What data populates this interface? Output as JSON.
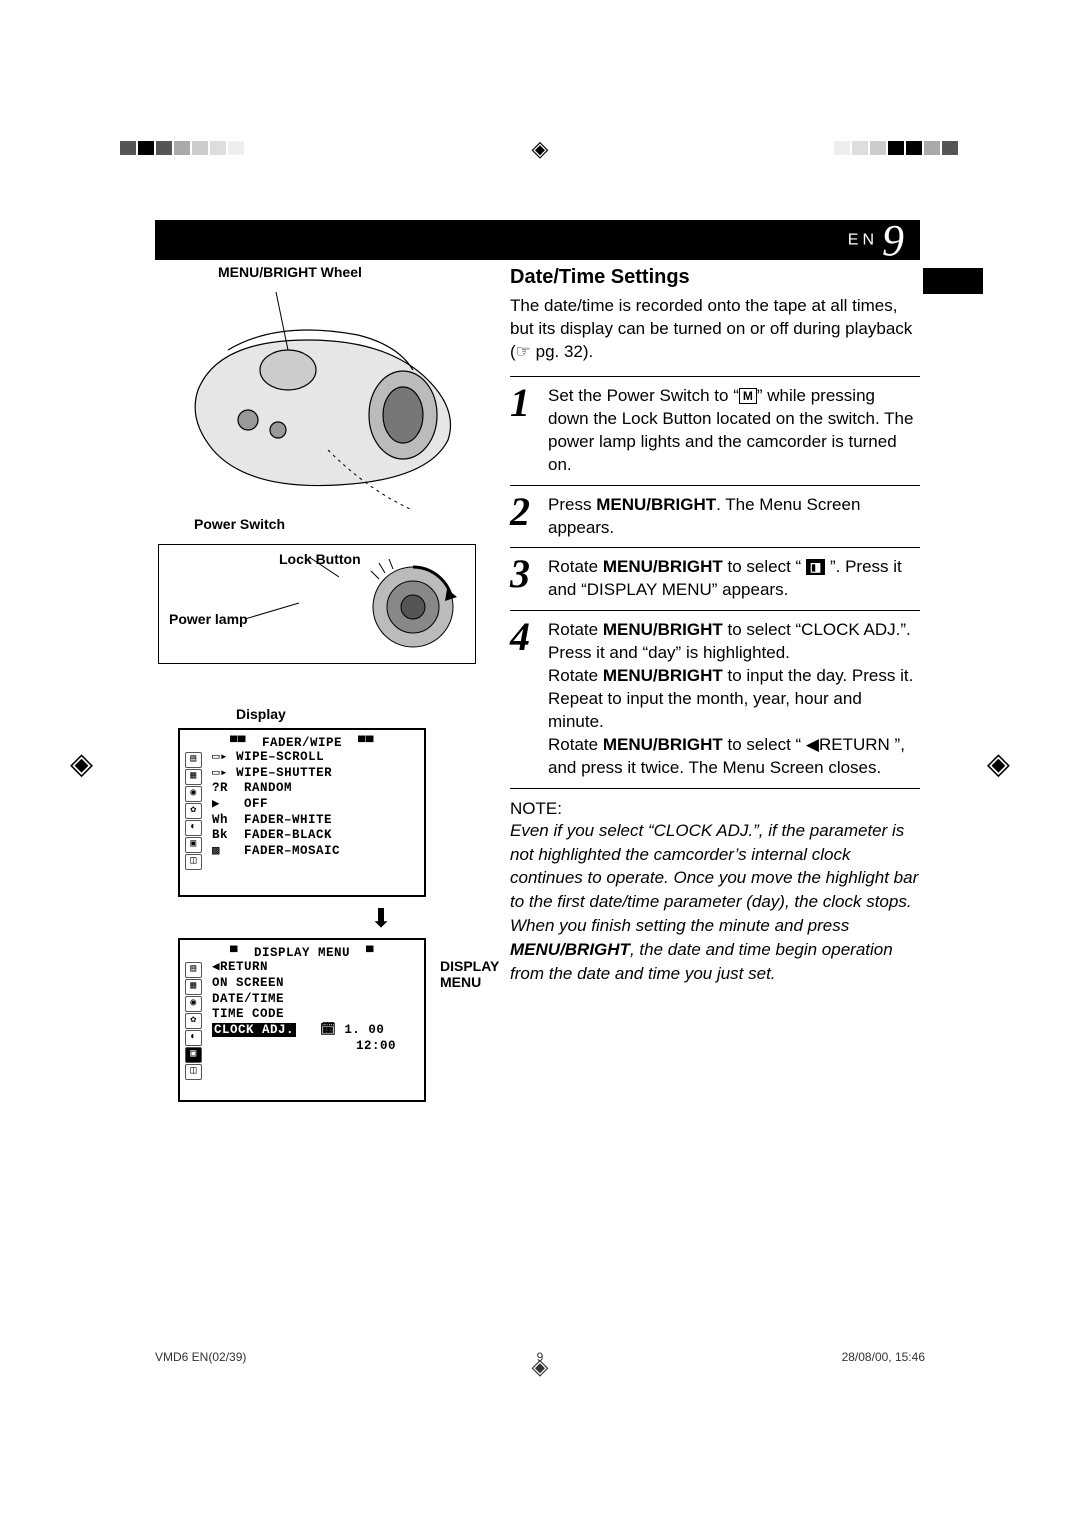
{
  "header": {
    "lang": "EN",
    "page_number": "9"
  },
  "left": {
    "wheel_label": "MENU/BRIGHT Wheel",
    "power_switch_label": "Power Switch",
    "lock_button_label": "Lock Button",
    "power_lamp_label": "Power lamp",
    "display_label": "Display",
    "osd1": {
      "title": "FADER/WIPE",
      "items": [
        "WIPE–SCROLL",
        "WIPE–SHUTTER",
        "RANDOM",
        "OFF",
        "FADER–WHITE",
        "FADER–BLACK",
        "FADER–MOSAIC"
      ]
    },
    "osd2_side_label": "DISPLAY MENU",
    "osd2": {
      "title": "DISPLAY MENU",
      "items": [
        "◀RETURN",
        "ON SCREEN",
        "DATE/TIME",
        "TIME CODE"
      ],
      "highlight": "CLOCK ADJ.",
      "clock_date": "1. 00",
      "clock_time": "12:00"
    }
  },
  "right": {
    "title": "Date/Time Settings",
    "intro": "The date/time is recorded onto the tape at all times, but its display can be turned on or off during playback (☞ pg. 32).",
    "step1": "Set the Power Switch to “ M ” while pressing down the Lock Button located on the switch. The power lamp lights and the camcorder is turned on.",
    "step2_a": "Press ",
    "step2_b": ". The Menu Screen appears.",
    "step3_a": "Rotate ",
    "step3_b": " to select “ ",
    "step3_c": " ”. Press it and “DISPLAY MENU” appears.",
    "step4_a": "Rotate ",
    "step4_b": " to select “CLOCK ADJ.”. Press it and “day” is highlighted.",
    "step4_c": "Rotate ",
    "step4_d": " to input the day. Press it. Repeat to input the month, year, hour and minute.",
    "step4_e": "Rotate ",
    "step4_f": " to select “ ◀RETURN ”, and press it twice. The Menu Screen closes.",
    "menu_bright": "MENU/BRIGHT",
    "note_label": "NOTE:",
    "note_body": "Even if you select “CLOCK ADJ.”, if the parameter is not highlighted the camcorder’s internal clock continues to operate. Once you move the highlight bar to the first date/time parameter (day), the clock stops. When you finish setting the minute and press MENU/BRIGHT, the date and time begin operation from the date and time you just set."
  },
  "footer": {
    "left": "VMD6 EN(02/39)",
    "center": "9",
    "right": "28/08/00, 15:46"
  }
}
